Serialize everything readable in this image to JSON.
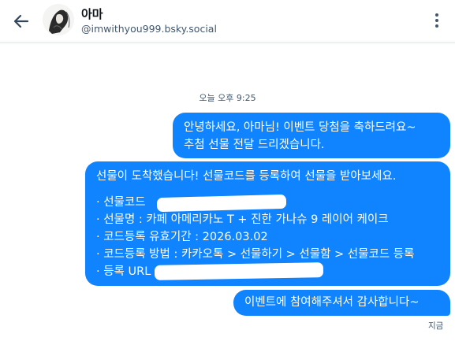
{
  "header": {
    "display_name": "아마",
    "handle": "@imwithyou999.bsky.social",
    "back_icon": "arrow-left-icon",
    "menu_icon": "vertical-ellipsis-icon"
  },
  "conversation": {
    "timestamp": "오늘 오후 9:25",
    "messages": [
      {
        "lines": [
          "안녕하세요, 아마님! 이벤트 당첨을 축하드려요~",
          "추첨 선물 전달 드리겠습니다."
        ]
      },
      {
        "lines": [
          "선물이 도착했습니다! 선물코드를 등록하여 선물을 받아보세요.",
          "· 선물코드",
          "· 선물명 : 카페 아메리카노 T + 진한 가나슈 9 레이어 케이크",
          "· 코드등록 유효기간 : 2026.03.02",
          "· 코드등록 방법 : 카카오톡 > 선물하기 > 선물함 > 선물코드 등록",
          "· 등록 URL"
        ]
      },
      {
        "lines": [
          "이벤트에 참여해주셔서 감사합니다~"
        ]
      }
    ],
    "sent_status": "지금"
  },
  "colors": {
    "bubble_blue": "#1083fe",
    "secondary_text": "#42576c"
  }
}
